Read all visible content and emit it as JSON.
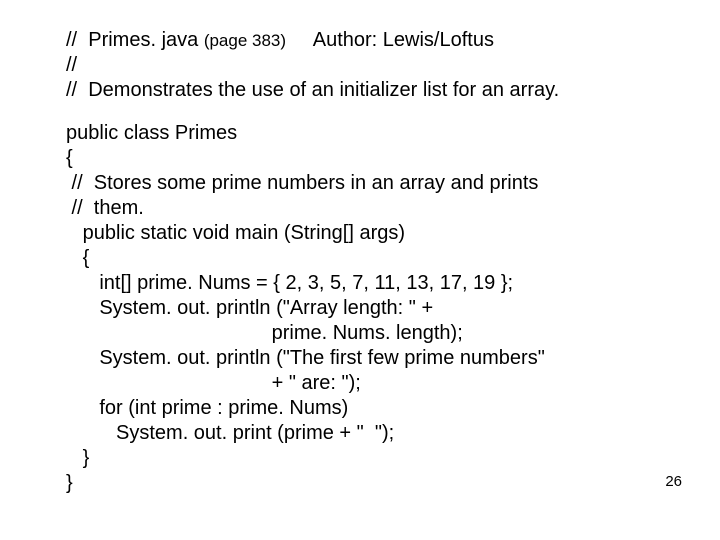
{
  "header": {
    "line1_prefix": "//  Primes. java ",
    "page_note": "(page 383)",
    "line1_suffix": "     Author: Lewis/Loftus",
    "line2": "//",
    "line3": "//  Demonstrates the use of an initializer list for an array."
  },
  "code": {
    "l1": "public class Primes",
    "l2": "{",
    "l3": " //  Stores some prime numbers in an array and prints",
    "l4": " //  them.",
    "l5": "   public static void main (String[] args)",
    "l6": "   {",
    "l7": "      int[] prime. Nums = { 2, 3, 5, 7, 11, 13, 17, 19 };",
    "l8": "",
    "l9": "      System. out. println (\"Array length: \" +",
    "l10": "                                     prime. Nums. length);",
    "l11": "",
    "l12": "      System. out. println (\"The first few prime numbers\"",
    "l13": "                                     + \" are: \");",
    "l14": "",
    "l15": "      for (int prime : prime. Nums)",
    "l16": "         System. out. print (prime + \"  \");",
    "l17": "   }",
    "l18": "}"
  },
  "page_number": "26",
  "chart_data": {
    "type": "table",
    "title": "Primes.java code listing",
    "source_page": 383,
    "author": "Lewis/Loftus",
    "prime_numbers_array": [
      2,
      3,
      5,
      7,
      11,
      13,
      17,
      19
    ]
  }
}
